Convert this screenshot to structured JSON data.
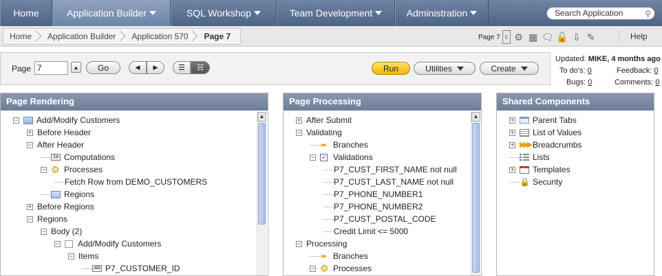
{
  "nav": {
    "tabs": [
      {
        "label": "Home",
        "caret": false
      },
      {
        "label": "Application Builder",
        "caret": true
      },
      {
        "label": "SQL Workshop",
        "caret": true
      },
      {
        "label": "Team Development",
        "caret": true
      },
      {
        "label": "Administration",
        "caret": true
      }
    ],
    "search_placeholder": "Search Application"
  },
  "breadcrumb": [
    "Home",
    "Application Builder",
    "Application 570",
    "Page 7"
  ],
  "page_tools": {
    "page_label": "Page 7"
  },
  "help_label": "Help",
  "controls": {
    "page_label": "Page",
    "page_value": "7",
    "go_label": "Go",
    "run_label": "Run",
    "utilities_label": "Utilities",
    "create_label": "Create"
  },
  "status": {
    "updated_label": "Updated:",
    "updated_value": "MIKE, 4 months ago",
    "todos_label": "To do's:",
    "todos_value": "0",
    "feedback_label": "Feedback:",
    "feedback_value": "0",
    "bugs_label": "Bugs:",
    "bugs_value": "0",
    "comments_label": "Comments:",
    "comments_value": "0"
  },
  "panels": {
    "rendering": {
      "title": "Page Rendering",
      "nodes": [
        {
          "label": "Add/Modify Customers",
          "level": 0,
          "toggle": "-",
          "icon": "page-icon"
        },
        {
          "label": "Before Header",
          "level": 1,
          "toggle": "+",
          "icon": ""
        },
        {
          "label": "After Header",
          "level": 1,
          "toggle": "-",
          "icon": ""
        },
        {
          "label": "Computations",
          "level": 2,
          "toggle": "",
          "icon": "computation-icon"
        },
        {
          "label": "Processes",
          "level": 2,
          "toggle": "-",
          "icon": "process-gear-icon"
        },
        {
          "label": "Fetch Row from DEMO_CUSTOMERS",
          "level": 3,
          "toggle": "",
          "icon": ""
        },
        {
          "label": "Regions",
          "level": 2,
          "toggle": "",
          "icon": "region-icon"
        },
        {
          "label": "Before Regions",
          "level": 1,
          "toggle": "+",
          "icon": ""
        },
        {
          "label": "Regions",
          "level": 1,
          "toggle": "-",
          "icon": ""
        },
        {
          "label": "Body (2)",
          "level": 2,
          "toggle": "-",
          "icon": ""
        },
        {
          "label": "Add/Modify Customers",
          "level": 3,
          "toggle": "-",
          "icon": "region-box-icon"
        },
        {
          "label": "Items",
          "level": 4,
          "toggle": "-",
          "icon": ""
        },
        {
          "label": "P7_CUSTOMER_ID",
          "level": 5,
          "toggle": "",
          "icon": "item-icon"
        }
      ]
    },
    "processing": {
      "title": "Page Processing",
      "nodes": [
        {
          "label": "After Submit",
          "level": 0,
          "toggle": "+",
          "icon": ""
        },
        {
          "label": "Validating",
          "level": 0,
          "toggle": "-",
          "icon": ""
        },
        {
          "label": "Branches",
          "level": 1,
          "toggle": "",
          "icon": "branch-arrow-icon"
        },
        {
          "label": "Validations",
          "level": 1,
          "toggle": "-",
          "icon": "validation-check-icon"
        },
        {
          "label": "P7_CUST_FIRST_NAME not null",
          "level": 2,
          "toggle": "",
          "icon": ""
        },
        {
          "label": "P7_CUST_LAST_NAME not null",
          "level": 2,
          "toggle": "",
          "icon": ""
        },
        {
          "label": "P7_PHONE_NUMBER1",
          "level": 2,
          "toggle": "",
          "icon": ""
        },
        {
          "label": "P7_PHONE_NUMBER2",
          "level": 2,
          "toggle": "",
          "icon": ""
        },
        {
          "label": "P7_CUST_POSTAL_CODE",
          "level": 2,
          "toggle": "",
          "icon": ""
        },
        {
          "label": "Credit Limit <= 5000",
          "level": 2,
          "toggle": "",
          "icon": ""
        },
        {
          "label": "Processing",
          "level": 0,
          "toggle": "-",
          "icon": ""
        },
        {
          "label": "Branches",
          "level": 1,
          "toggle": "",
          "icon": "branch-arrow-icon"
        },
        {
          "label": "Processes",
          "level": 1,
          "toggle": "-",
          "icon": "process-gear-icon"
        }
      ]
    },
    "shared": {
      "title": "Shared Components",
      "nodes": [
        {
          "label": "Parent Tabs",
          "level": 0,
          "toggle": "+",
          "icon": "tabs-icon"
        },
        {
          "label": "List of Values",
          "level": 0,
          "toggle": "+",
          "icon": "lov-icon"
        },
        {
          "label": "Breadcrumbs",
          "level": 0,
          "toggle": "+",
          "icon": "breadcrumbs-icon"
        },
        {
          "label": "Lists",
          "level": 0,
          "toggle": "",
          "icon": "lists-icon"
        },
        {
          "label": "Templates",
          "level": 0,
          "toggle": "+",
          "icon": "templates-icon"
        },
        {
          "label": "Security",
          "level": 0,
          "toggle": "",
          "icon": "lock-icon"
        }
      ]
    }
  }
}
